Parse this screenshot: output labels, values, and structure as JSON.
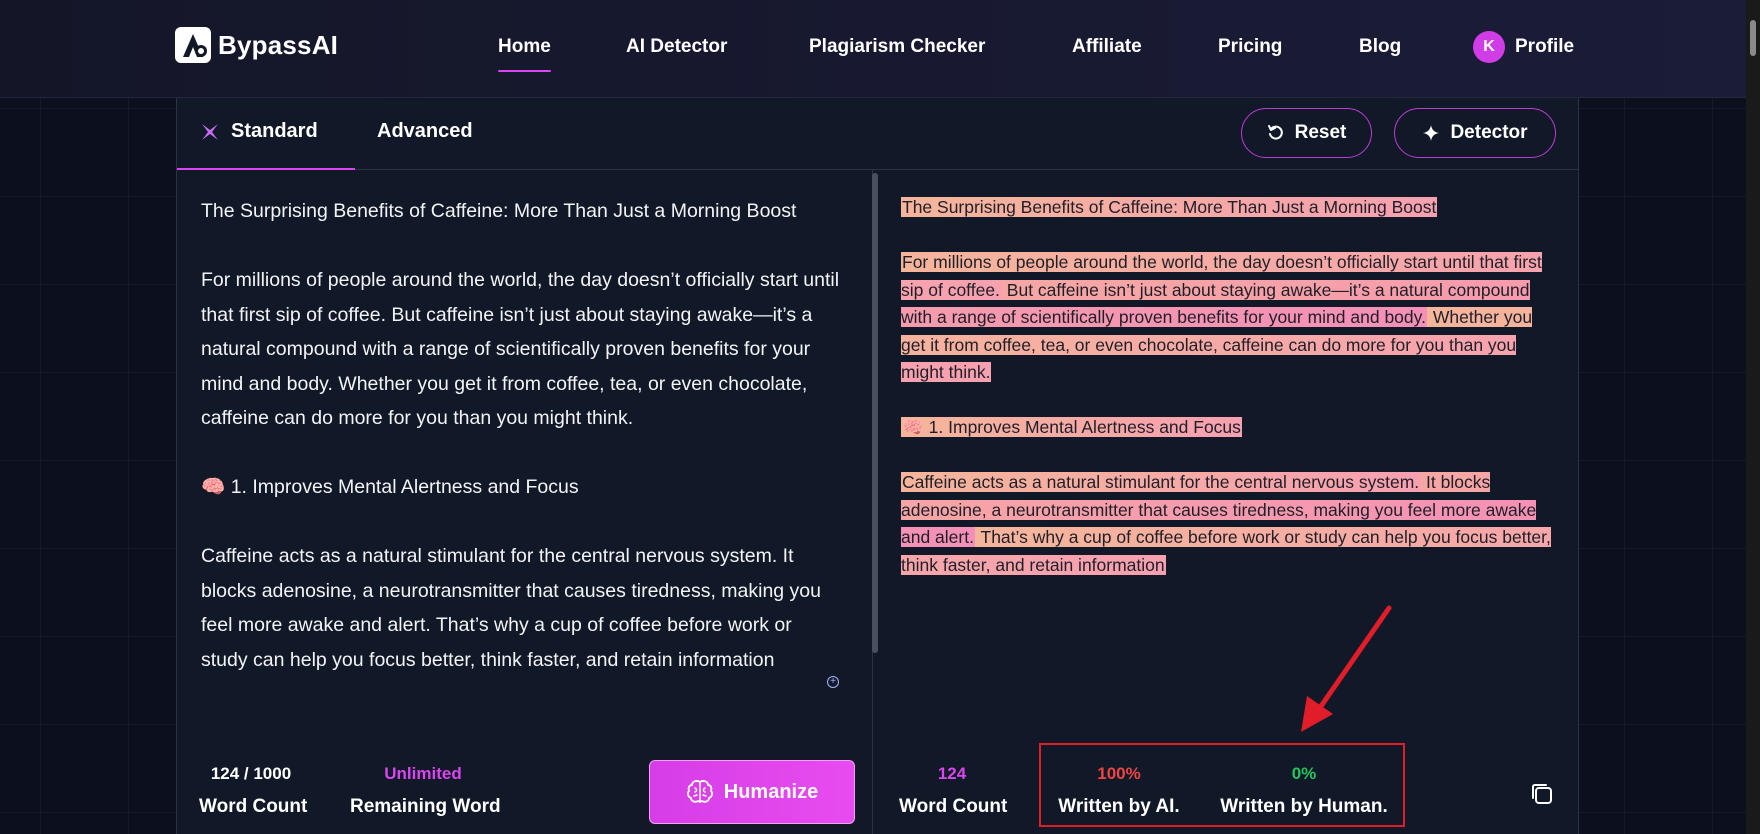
{
  "brand": {
    "name": "BypassAI"
  },
  "nav": {
    "items": [
      {
        "label": "Home",
        "active": true
      },
      {
        "label": "AI Detector",
        "active": false
      },
      {
        "label": "Plagiarism Checker",
        "active": false
      },
      {
        "label": "Affiliate",
        "active": false
      },
      {
        "label": "Pricing",
        "active": false
      },
      {
        "label": "Blog",
        "active": false
      }
    ],
    "profile": {
      "avatar_letter": "K",
      "label": "Profile"
    }
  },
  "tabs": {
    "standard": "Standard",
    "advanced": "Advanced",
    "active": "Standard"
  },
  "actions": {
    "reset": "Reset",
    "detector": "Detector"
  },
  "input_text": {
    "title": "The Surprising Benefits of Caffeine: More Than Just a Morning Boost",
    "para1": "For millions of people around the world, the day doesn’t officially start until that first sip of coffee. But caffeine isn’t just about staying awake—it’s a natural compound with a range of scientifically proven benefits for your mind and body. Whether you get it from coffee, tea, or even chocolate, caffeine can do more for you than you might think.",
    "heading1_icon": "🧠",
    "heading1": "1. Improves Mental Alertness and Focus",
    "para2": "Caffeine acts as a natural stimulant for the central nervous system. It blocks adenosine, a neurotransmitter that causes tiredness, making you feel more awake and alert. That’s why a cup of coffee before work or study can help you focus better, think faster, and retain information"
  },
  "output_text": {
    "title": "The Surprising Benefits of Caffeine: More Than Just a Morning Boost",
    "para1_a": "For millions of people around the world, the day doesn’t officially start until that first sip of coffee.",
    "para1_b": " But caffeine isn’t just about staying awake—it’s a natural compound with a range of scientifically proven benefits for your mind and body.",
    "para1_c": " Whether you get it from coffee, tea, or even chocolate, caffeine can do more for you than you might think.",
    "heading1_icon": "🧠",
    "heading1": "1. Improves Mental Alertness and Focus",
    "para2_a": "Caffeine acts as a natural stimulant for the central nervous system.",
    "para2_b": " It blocks adenosine, a neurotransmitter that causes tiredness, making you feel more awake and alert.",
    "para2_c": " That’s why a cup of coffee before work or study can help you focus better, think faster, and retain information"
  },
  "input_stats": {
    "word_count_value": "124 / 1000",
    "word_count_label": "Word Count",
    "remaining_value": "Unlimited",
    "remaining_label": "Remaining Word"
  },
  "humanize_label": "Humanize",
  "output_stats": {
    "word_count_value": "124",
    "word_count_label": "Word Count",
    "ai_value": "100%",
    "ai_label": "Written by AI.",
    "human_value": "0%",
    "human_label": "Written by Human."
  },
  "colors": {
    "accent": "#d946ef",
    "ai_red": "#ef4444",
    "human_green": "#22c55e",
    "annotation_red": "#e11d2a"
  }
}
